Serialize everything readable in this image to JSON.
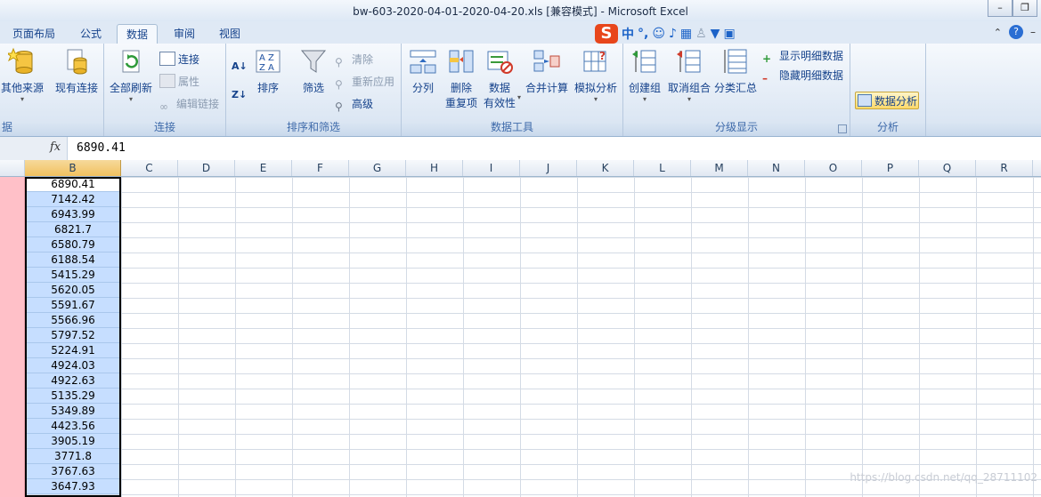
{
  "window": {
    "title": "bw-603-2020-04-01-2020-04-20.xls  [兼容模式] - Microsoft Excel"
  },
  "tabs": [
    "页面布局",
    "公式",
    "数据",
    "审阅",
    "视图"
  ],
  "active_tab": "数据",
  "ribbon": {
    "groups": {
      "get_external": {
        "label": "据",
        "other_sources": "其他来源",
        "existing": "现有连接"
      },
      "connections": {
        "label": "连接",
        "refresh_all": "全部刷新",
        "connections": "连接",
        "properties": "属性",
        "edit_links": "编辑链接"
      },
      "sort_filter": {
        "label": "排序和筛选",
        "sort": "排序",
        "filter": "筛选",
        "clear": "清除",
        "reapply": "重新应用",
        "advanced": "高级"
      },
      "data_tools": {
        "label": "数据工具",
        "text_to_columns": "分列",
        "remove_dup_1": "删除",
        "remove_dup_2": "重复项",
        "validation_1": "数据",
        "validation_2": "有效性",
        "consolidate": "合并计算",
        "what_if": "模拟分析"
      },
      "outline": {
        "label": "分级显示",
        "group": "创建组",
        "ungroup": "取消组合",
        "subtotal": "分类汇总",
        "show_detail": "显示明细数据",
        "hide_detail": "隐藏明细数据"
      },
      "analysis": {
        "label": "分析",
        "data_analysis": "数据分析"
      }
    }
  },
  "formula_bar": {
    "fx": "fx",
    "value": "6890.41"
  },
  "columns": [
    "B",
    "C",
    "D",
    "E",
    "F",
    "G",
    "H",
    "I",
    "J",
    "K",
    "L",
    "M",
    "N",
    "O",
    "P",
    "Q",
    "R"
  ],
  "selected_column": "B",
  "column_b_values": [
    "6890.41",
    "7142.42",
    "6943.99",
    "6821.7",
    "6580.79",
    "6188.54",
    "5415.29",
    "5620.05",
    "5591.67",
    "5566.96",
    "5797.52",
    "5224.91",
    "4924.03",
    "4922.63",
    "5135.29",
    "5349.89",
    "4423.56",
    "3905.19",
    "3771.8",
    "3767.63",
    "3647.93"
  ],
  "watermark": "https://blog.csdn.net/qq_28711102",
  "colors": {
    "selection": "#c6deff",
    "row_header": "#ffc0c8",
    "selected_header": "#f1c15f"
  }
}
